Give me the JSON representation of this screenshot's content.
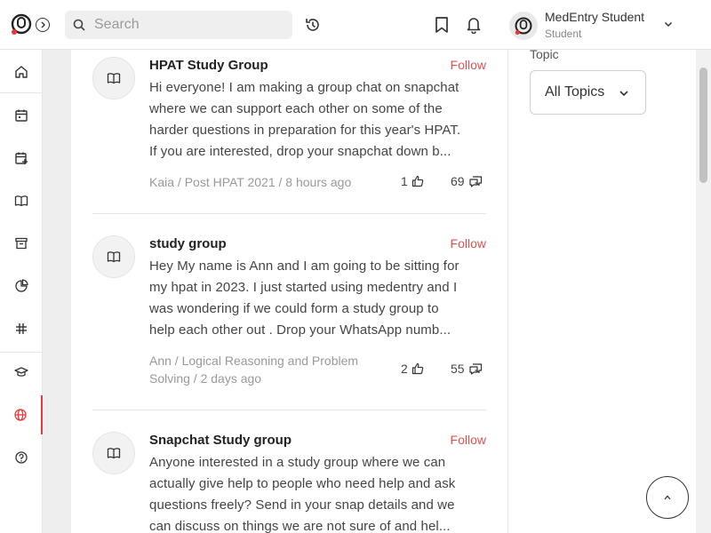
{
  "header": {
    "search_placeholder": "Search",
    "user": {
      "name": "MedEntry Student",
      "role": "Student"
    }
  },
  "sidebar": {
    "items": [
      {
        "icon": "home-icon"
      },
      {
        "icon": "calendar-icon"
      },
      {
        "icon": "calendar-add-icon"
      },
      {
        "icon": "book-icon"
      },
      {
        "icon": "archive-icon"
      },
      {
        "icon": "pie-chart-icon"
      },
      {
        "icon": "hashtag-icon"
      },
      {
        "icon": "graduation-cap-icon"
      },
      {
        "icon": "globe-icon",
        "active": true
      },
      {
        "icon": "help-icon"
      }
    ]
  },
  "feed": {
    "posts": [
      {
        "title": "HPAT Study Group",
        "follow_label": "Follow",
        "body_lines": [
          "Hi everyone! I am making a group chat on snapchat",
          "where we can support each other on some of the",
          "harder questions in preparation for this year's HPAT.",
          "If you are interested, drop your snapchat down b..."
        ],
        "meta": "Kaia / Post HPAT 2021 / 8 hours ago",
        "likes": "1",
        "comments": "69"
      },
      {
        "title": "study group",
        "follow_label": "Follow",
        "body_lines": [
          "Hey My name is Ann and I am going to be sitting for",
          "my hpat in 2023. I just started using medentry and I",
          "was wondering if we could form a study group to",
          "help each other out . Drop your WhatsApp numb..."
        ],
        "meta": "Ann / Logical Reasoning and Problem Solving / 2 days ago",
        "likes": "2",
        "comments": "55"
      },
      {
        "title": "Snapchat Study group",
        "follow_label": "Follow",
        "body_lines": [
          "Anyone interested in a study group where we can",
          "actually give help to people who need help and ask",
          "questions freely? Send in your snap details and we",
          "can discuss on things we are not sure of and hel..."
        ],
        "meta": "",
        "likes": "",
        "comments": ""
      }
    ]
  },
  "filter": {
    "label": "Topic",
    "selected": "All Topics"
  },
  "colors": {
    "accent": "#e05252",
    "background": "#eeeeee"
  }
}
